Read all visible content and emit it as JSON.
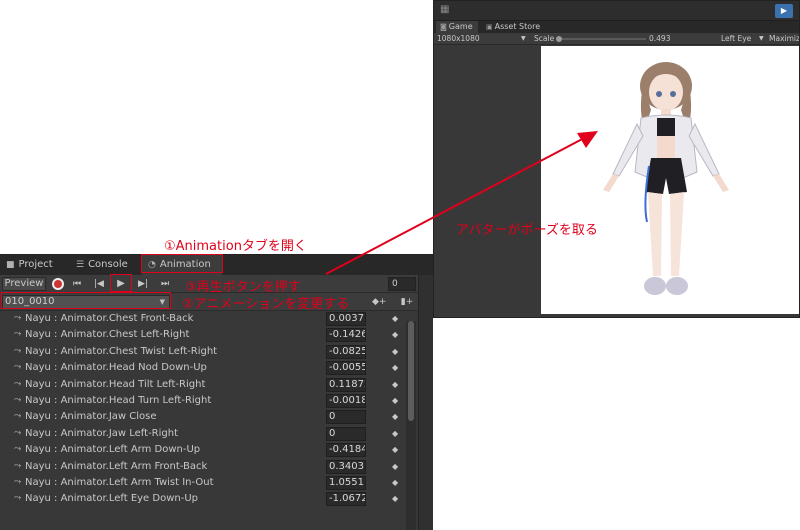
{
  "game": {
    "tabs": [
      {
        "label": "Game"
      },
      {
        "label": "Asset Store"
      }
    ],
    "resolution": "1080x1080",
    "scale_label": "Scale",
    "scale_value": "0.493",
    "eye": "Left Eye",
    "maximize": "Maximiz"
  },
  "animation": {
    "tabs": [
      {
        "label": "Project"
      },
      {
        "label": "Console"
      },
      {
        "label": "Animation"
      }
    ],
    "preview_label": "Preview",
    "frame": "0",
    "clip": "010_0010",
    "properties": [
      {
        "name": "Nayu : Animator.Chest Front-Back",
        "value": "0.0037"
      },
      {
        "name": "Nayu : Animator.Chest Left-Right",
        "value": "-0.1426"
      },
      {
        "name": "Nayu : Animator.Chest Twist Left-Right",
        "value": "-0.0825"
      },
      {
        "name": "Nayu : Animator.Head Nod Down-Up",
        "value": "-0.0055"
      },
      {
        "name": "Nayu : Animator.Head Tilt Left-Right",
        "value": "0.11872"
      },
      {
        "name": "Nayu : Animator.Head Turn Left-Right",
        "value": "-0.0018"
      },
      {
        "name": "Nayu : Animator.Jaw Close",
        "value": "0"
      },
      {
        "name": "Nayu : Animator.Jaw Left-Right",
        "value": "0"
      },
      {
        "name": "Nayu : Animator.Left Arm Down-Up",
        "value": "-0.4184"
      },
      {
        "name": "Nayu : Animator.Left Arm Front-Back",
        "value": "0.3403"
      },
      {
        "name": "Nayu : Animator.Left Arm Twist In-Out",
        "value": "1.0551"
      },
      {
        "name": "Nayu : Animator.Left Eye Down-Up",
        "value": "-1.0672"
      }
    ]
  },
  "annotations": {
    "open_tab": "①Animationタブを開く",
    "change_clip": "②アニメーションを変更する",
    "press_play": "③再生ボタンを押す",
    "avatar_pose": "アバターがポーズを取る"
  },
  "colors": {
    "annotation": "#e0001b",
    "panel_bg": "#383838",
    "tab_bg": "#282828",
    "field_bg": "#2a2a2a"
  }
}
